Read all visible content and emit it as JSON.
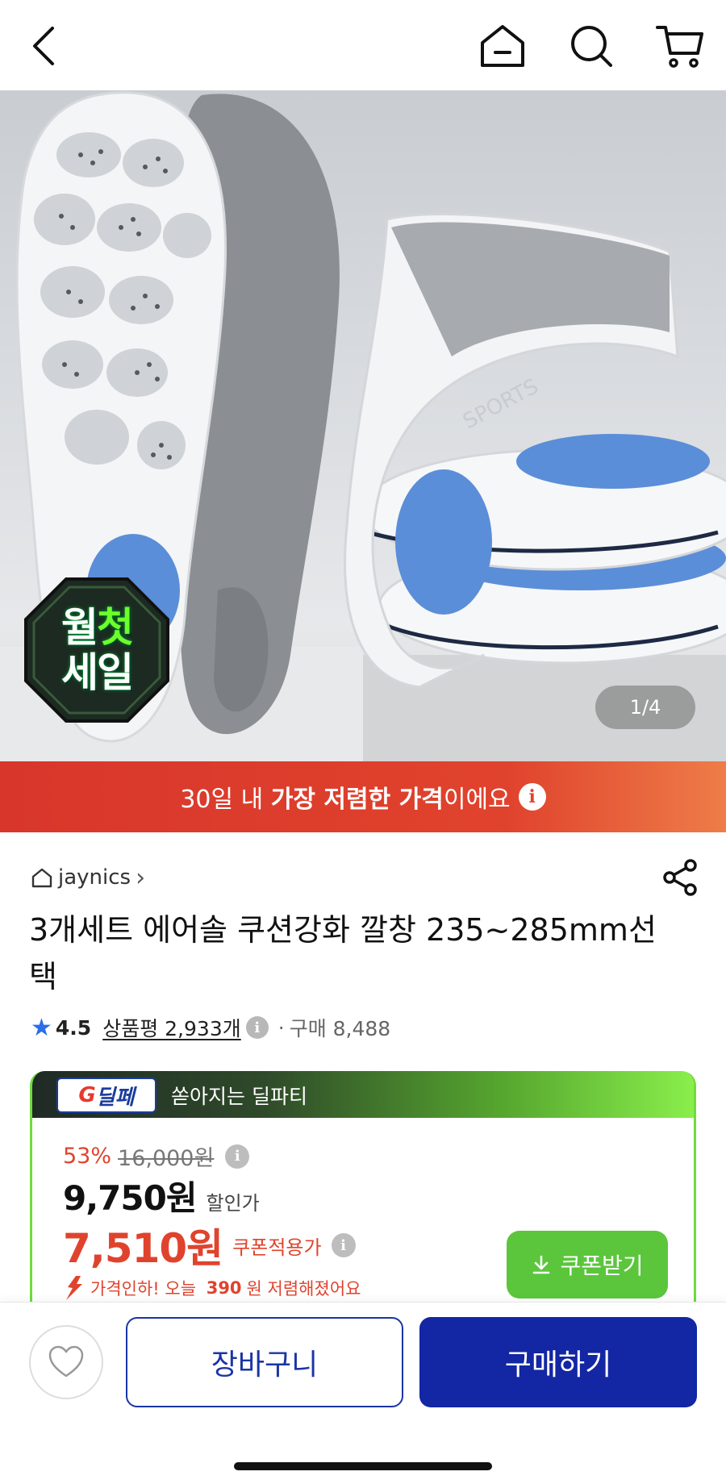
{
  "nav": {
    "back_icon": "chevron-left-icon",
    "home_icon": "home-icon",
    "search_icon": "search-icon",
    "cart_icon": "cart-icon"
  },
  "hero": {
    "badge_line1_a": "월",
    "badge_line1_b": "첫",
    "badge_line2": "세일",
    "product_print": "SPORTS",
    "pager": "1/4"
  },
  "price_banner": {
    "prefix": "30일 내 ",
    "bold": "가장 저렴한 가격",
    "suffix": "이에요",
    "info_icon": "i"
  },
  "product": {
    "seller": "jaynics",
    "seller_chevron": "›",
    "title": "3개세트 에어솔 쿠션강화 깔창 235~285mm선택",
    "rating": "4.5",
    "reviews_label": "상품평 2,933개",
    "separator": "·",
    "purchases": "구매 8,488"
  },
  "deal": {
    "logo_a": "G",
    "logo_b": "딜페",
    "label": "쏟아지는 딜파티",
    "discount_pct": "53%",
    "original_price": "16,000원",
    "sale_price": "9,750원",
    "sale_label": "할인가",
    "coupon_price": "7,510원",
    "coupon_label": "쿠폰적용가",
    "drop_prefix": "가격인하! 오늘 ",
    "drop_amount": "390",
    "drop_suffix": "원 저렴해졌어요",
    "coupon_button": "쿠폰받기"
  },
  "bottom": {
    "like_icon": "heart-icon",
    "cart_label": "장바구니",
    "buy_label": "구매하기"
  },
  "colors": {
    "accent_red": "#e0432d",
    "buy_blue": "#1326a3",
    "coupon_green": "#5bc63c",
    "rating_blue": "#2a6ee8"
  }
}
